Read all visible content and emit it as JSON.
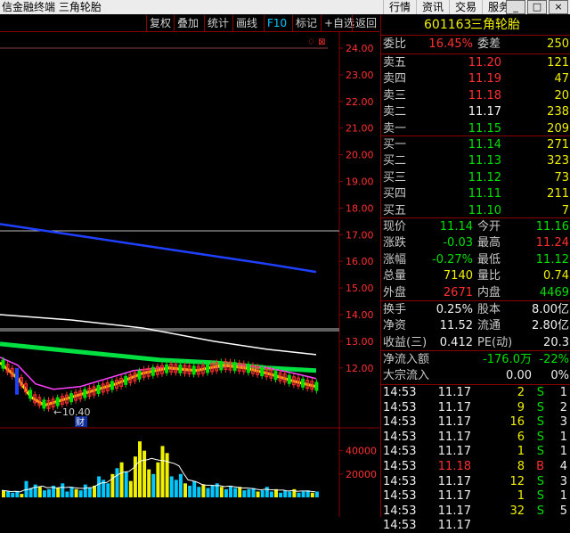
{
  "titlebar": {
    "app_title": "信金融终端  三角轮胎",
    "menu": [
      "行情",
      "资讯",
      "交易",
      "服务"
    ],
    "window_buttons": [
      "_",
      "□",
      "×"
    ]
  },
  "toolbar": {
    "buttons": [
      "复权",
      "叠加",
      "统计",
      "画线",
      "F10",
      "标记",
      "+自选",
      "返回"
    ]
  },
  "price_axis": {
    "ticks": [
      "24.00",
      "23.00",
      "22.00",
      "21.00",
      "20.00",
      "19.00",
      "18.00",
      "17.00",
      "16.00",
      "15.00",
      "14.00",
      "13.00",
      "12.00"
    ],
    "low_marker": "10.40",
    "cai_label": "财"
  },
  "volume_axis": {
    "ticks": [
      "40000",
      "20000"
    ]
  },
  "stock": {
    "code": "601163",
    "name": "三角轮胎"
  },
  "weibi": {
    "label": "委比",
    "pct": "16.45%",
    "diff_label": "委差",
    "diff": "250"
  },
  "asks": [
    {
      "label": "卖五",
      "price": "11.20",
      "vol": "121",
      "color": "red"
    },
    {
      "label": "卖四",
      "price": "11.19",
      "vol": "47",
      "color": "red"
    },
    {
      "label": "卖三",
      "price": "11.18",
      "vol": "20",
      "color": "red"
    },
    {
      "label": "卖二",
      "price": "11.17",
      "vol": "238",
      "color": "white"
    },
    {
      "label": "卖一",
      "price": "11.15",
      "vol": "209",
      "color": "green"
    }
  ],
  "bids": [
    {
      "label": "买一",
      "price": "11.14",
      "vol": "271",
      "color": "green"
    },
    {
      "label": "买二",
      "price": "11.13",
      "vol": "323",
      "color": "green"
    },
    {
      "label": "买三",
      "price": "11.12",
      "vol": "73",
      "color": "green"
    },
    {
      "label": "买四",
      "price": "11.11",
      "vol": "211",
      "color": "green"
    },
    {
      "label": "买五",
      "price": "11.10",
      "vol": "7",
      "color": "green"
    }
  ],
  "quote": [
    {
      "l1": "现价",
      "v1": "11.14",
      "c1": "green",
      "l2": "今开",
      "v2": "11.16",
      "c2": "green"
    },
    {
      "l1": "涨跌",
      "v1": "-0.03",
      "c1": "green",
      "l2": "最高",
      "v2": "11.24",
      "c2": "red"
    },
    {
      "l1": "涨幅",
      "v1": "-0.27%",
      "c1": "green",
      "l2": "最低",
      "v2": "11.12",
      "c2": "green"
    },
    {
      "l1": "总量",
      "v1": "7140",
      "c1": "yellow",
      "l2": "量比",
      "v2": "0.74",
      "c2": "yellow"
    },
    {
      "l1": "外盘",
      "v1": "2671",
      "c1": "red",
      "l2": "内盘",
      "v2": "4469",
      "c2": "green"
    }
  ],
  "stats": [
    {
      "l1": "换手",
      "v1": "0.25%",
      "l2": "股本",
      "v2": "8.00亿"
    },
    {
      "l1": "净资",
      "v1": "11.52",
      "l2": "流通",
      "v2": "2.80亿"
    },
    {
      "l1": "收益(三)",
      "v1": "0.412",
      "l2": "PE(动)",
      "v2": "20.3"
    }
  ],
  "flow": [
    {
      "label": "净流入额",
      "v1": "-176.0万",
      "c1": "green",
      "v2": "-22%",
      "c2": "green"
    },
    {
      "label": "大宗流入",
      "v1": "0.00",
      "c1": "white",
      "v2": "0%",
      "c2": "white"
    }
  ],
  "trades": [
    {
      "time": "14:53",
      "price": "11.17",
      "pc": "white",
      "vol": "2",
      "side": "S",
      "sc": "green",
      "n": "1"
    },
    {
      "time": "14:53",
      "price": "11.17",
      "pc": "white",
      "vol": "9",
      "side": "S",
      "sc": "green",
      "n": "2"
    },
    {
      "time": "14:53",
      "price": "11.17",
      "pc": "white",
      "vol": "16",
      "side": "S",
      "sc": "green",
      "n": "3"
    },
    {
      "time": "14:53",
      "price": "11.17",
      "pc": "white",
      "vol": "6",
      "side": "S",
      "sc": "green",
      "n": "1"
    },
    {
      "time": "14:53",
      "price": "11.17",
      "pc": "white",
      "vol": "1",
      "side": "S",
      "sc": "green",
      "n": "1"
    },
    {
      "time": "14:53",
      "price": "11.18",
      "pc": "red",
      "vol": "8",
      "side": "B",
      "sc": "red",
      "n": "4"
    },
    {
      "time": "14:53",
      "price": "11.17",
      "pc": "white",
      "vol": "12",
      "side": "S",
      "sc": "green",
      "n": "3"
    },
    {
      "time": "14:53",
      "price": "11.17",
      "pc": "white",
      "vol": "1",
      "side": "S",
      "sc": "green",
      "n": "1"
    },
    {
      "time": "14:53",
      "price": "11.17",
      "pc": "white",
      "vol": "32",
      "side": "S",
      "sc": "green",
      "n": "5"
    },
    {
      "time": "14:53",
      "price": "11.17",
      "pc": "white",
      "vol": "",
      "side": "",
      "sc": "green",
      "n": ""
    }
  ],
  "colors": {
    "up": "#ff3030",
    "down": "#00e000",
    "ma1": "#ffffff",
    "ma2": "#00e040",
    "ma3": "#ff40ff",
    "ma4": "#2040ff",
    "vol_up": "#f0f000",
    "vol_down": "#00c8ff"
  },
  "chart_data": {
    "type": "candlestick",
    "y_ticks": [
      24,
      23,
      22,
      21,
      20,
      19,
      18,
      17,
      16,
      15,
      14,
      13,
      12
    ],
    "ylim": [
      10.2,
      24.5
    ],
    "low_marker": 10.4,
    "ma_blue": [
      [
        0,
        17.4
      ],
      [
        100,
        16.9
      ],
      [
        200,
        16.4
      ],
      [
        300,
        15.9
      ],
      [
        355,
        15.6
      ]
    ],
    "ma_white": [
      [
        0,
        14.0
      ],
      [
        80,
        13.8
      ],
      [
        160,
        13.5
      ],
      [
        240,
        13.0
      ],
      [
        300,
        12.7
      ],
      [
        355,
        12.5
      ]
    ],
    "ma_green": [
      [
        0,
        12.9
      ],
      [
        60,
        12.7
      ],
      [
        120,
        12.5
      ],
      [
        180,
        12.3
      ],
      [
        240,
        12.2
      ],
      [
        300,
        12.0
      ],
      [
        355,
        11.9
      ]
    ],
    "ma_magenta": [
      [
        0,
        12.4
      ],
      [
        20,
        12.1
      ],
      [
        40,
        11.4
      ],
      [
        60,
        11.2
      ],
      [
        90,
        11.3
      ],
      [
        120,
        11.6
      ],
      [
        150,
        11.9
      ],
      [
        180,
        12.0
      ],
      [
        210,
        11.9
      ],
      [
        240,
        12.0
      ],
      [
        270,
        12.1
      ],
      [
        300,
        12.0
      ],
      [
        330,
        11.8
      ],
      [
        355,
        11.6
      ]
    ],
    "ma_yellow": [
      [
        0,
        12.2
      ],
      [
        20,
        11.6
      ],
      [
        35,
        10.9
      ],
      [
        50,
        10.6
      ],
      [
        70,
        10.8
      ],
      [
        100,
        11.1
      ],
      [
        130,
        11.4
      ],
      [
        160,
        11.8
      ],
      [
        190,
        12.0
      ],
      [
        220,
        11.9
      ],
      [
        250,
        12.1
      ],
      [
        275,
        12.0
      ],
      [
        300,
        11.8
      ],
      [
        330,
        11.5
      ],
      [
        355,
        11.3
      ]
    ],
    "volume_ylim": [
      0,
      55000
    ],
    "volume_ticks": [
      40000,
      20000
    ],
    "volumes": [
      6000,
      5000,
      4000,
      5500,
      3000,
      14000,
      8000,
      11000,
      9000,
      6000,
      7000,
      10000,
      8000,
      12000,
      5000,
      9000,
      7000,
      6000,
      11000,
      8000,
      10000,
      18000,
      15000,
      12000,
      20000,
      25000,
      30000,
      22000,
      14000,
      35000,
      48000,
      40000,
      24000,
      20000,
      30000,
      44000,
      38000,
      18000,
      15000,
      20000,
      12000,
      10000,
      14000,
      9000,
      11000,
      8000,
      10000,
      12000,
      9000,
      7000,
      10000,
      8000,
      9000,
      6000,
      7000,
      8000,
      5000,
      6000,
      9000,
      5000,
      7000,
      4000,
      6000,
      5000,
      7000,
      4000,
      5000,
      6000,
      4000,
      5000
    ]
  }
}
